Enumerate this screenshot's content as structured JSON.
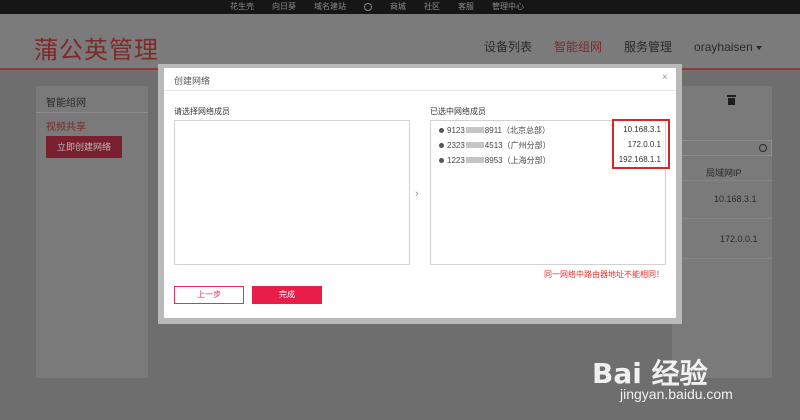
{
  "topbar": {
    "items": [
      "花生壳",
      "向日葵",
      "域名建站",
      "",
      "商城",
      "社区",
      "客服",
      "管理中心"
    ]
  },
  "header": {
    "brand": "蒲公英管理",
    "nav": [
      {
        "label": "设备列表",
        "active": false
      },
      {
        "label": "智能组网",
        "active": true
      },
      {
        "label": "服务管理",
        "active": false
      }
    ],
    "user": "orayhaisen"
  },
  "sidebar": {
    "title": "智能组网",
    "active_item": "视频共享",
    "create_button": "立即创建网络"
  },
  "content": {
    "column_header": "局域网IP",
    "rows": [
      "10.168.3.1",
      "172.0.0.1"
    ]
  },
  "modal": {
    "title": "创建网络",
    "close": "×",
    "left_label": "请选择网络成员",
    "right_label": "已选中网络成员",
    "members": [
      {
        "id_prefix": "9123",
        "id_suffix": "8911",
        "location": "（北京总部）",
        "ip": "10.168.3.1"
      },
      {
        "id_prefix": "2323",
        "id_suffix": "4513",
        "location": "（广州分部）",
        "ip": "172.0.0.1"
      },
      {
        "id_prefix": "1223",
        "id_suffix": "8953",
        "location": "（上海分部）",
        "ip": "192.168.1.1"
      }
    ],
    "warning": "同一网络中路由器地址不能相同！",
    "prev_button": "上一步",
    "done_button": "完成"
  },
  "watermark": {
    "logo": "Bai 经验",
    "url": "jingyan.baidu.com"
  }
}
